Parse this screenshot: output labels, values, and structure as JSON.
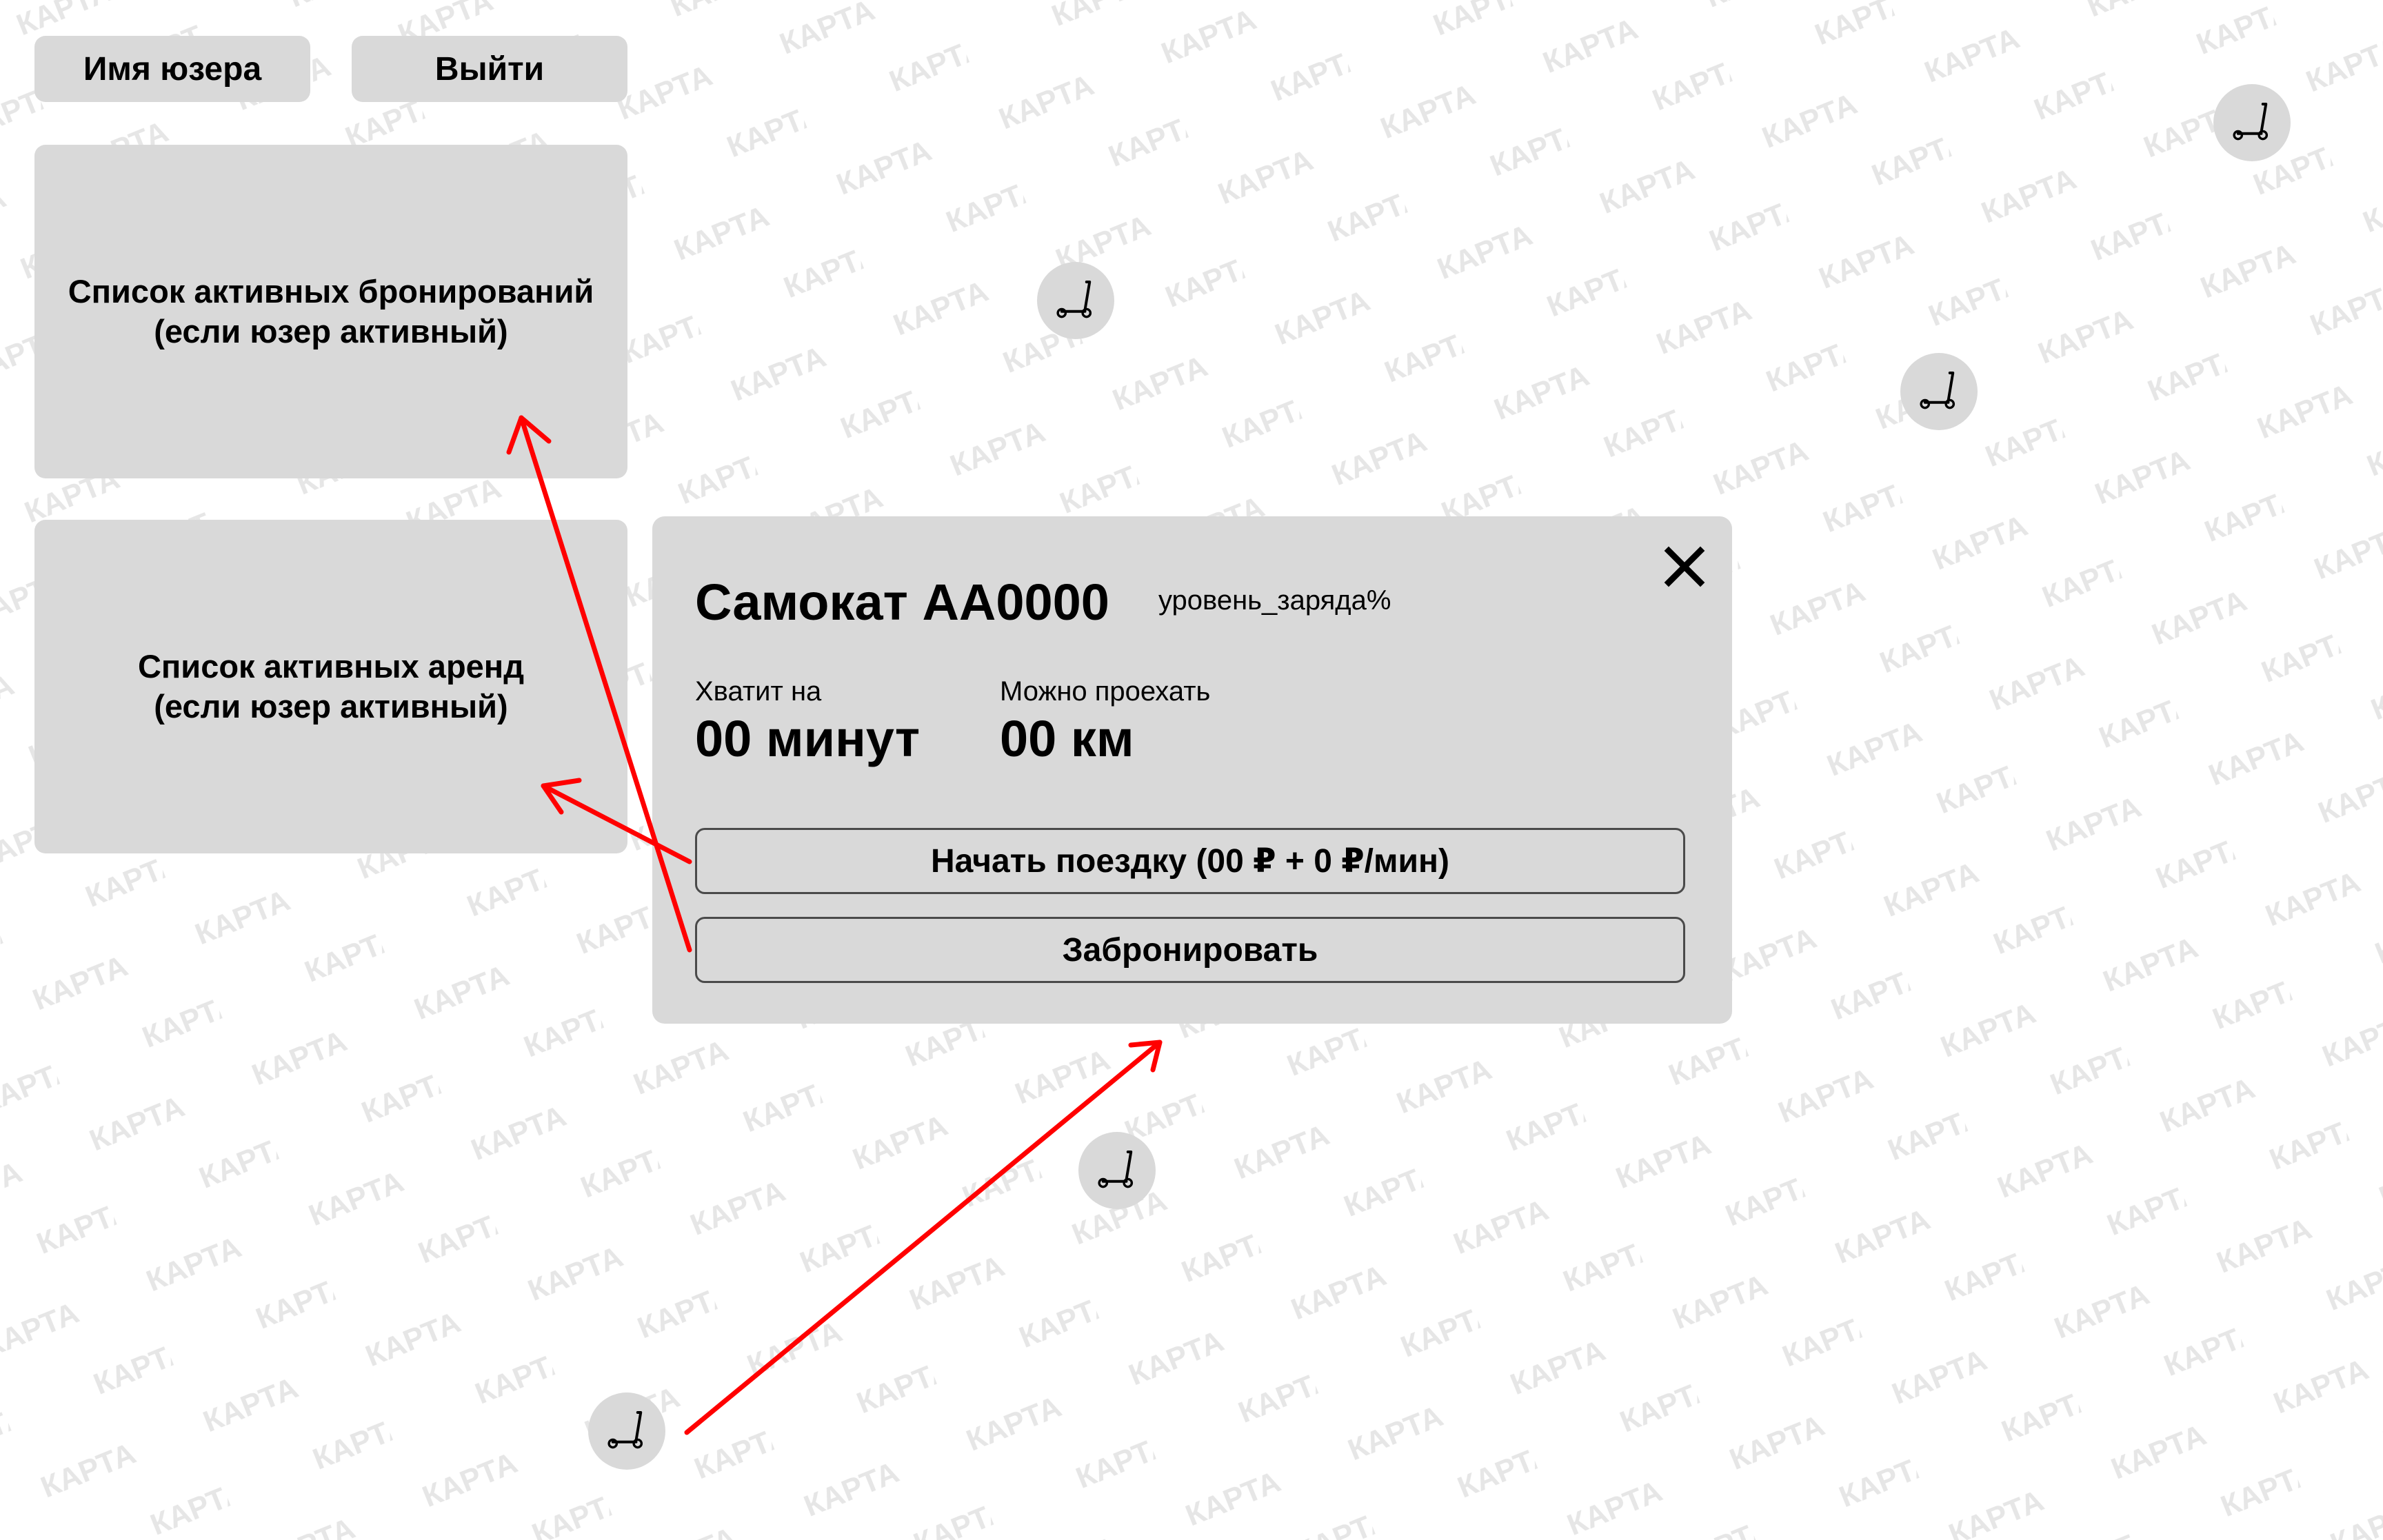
{
  "map": {
    "watermark_text": "КАРТА",
    "watermark_color": "#e6e6e6"
  },
  "header": {
    "user_label": "Имя юзера",
    "logout_label": "Выйти"
  },
  "panels": {
    "bookings_line1": "Список активных бронирований",
    "bookings_line2": "(если юзер активный)",
    "rentals_line1": "Список активных аренд",
    "rentals_line2": "(если юзер активный)"
  },
  "popup": {
    "title": "Самокат АА0000",
    "battery": "уровень_заряда%",
    "time_label": "Хватит на",
    "time_value": "00 минут",
    "distance_label": "Можно проехать",
    "distance_value": "00 км",
    "start_button": "Начать поездку (00 ₽ + 0 ₽/мин)",
    "book_button": "Забронировать"
  },
  "colors": {
    "panel_gray": "#d9d9d9",
    "arrow_red": "#ff0000"
  },
  "icons": {
    "scooter": "scooter-icon",
    "close": "close-icon"
  }
}
